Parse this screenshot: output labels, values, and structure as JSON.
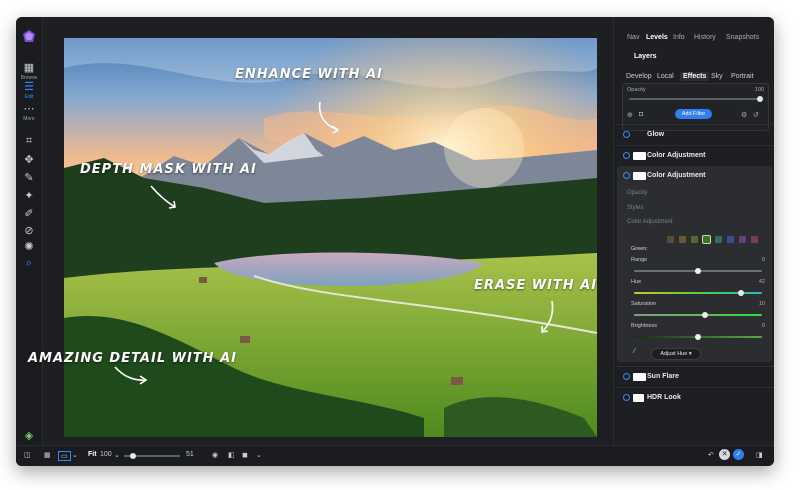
{
  "toolbar": {
    "browse_label": "Browse",
    "edit_label": "Edit",
    "more_label": "More"
  },
  "photo": {
    "callouts": [
      "ENHANCE WITH AI",
      "DEPTH MASK WITH AI",
      "ERASE WITH AI",
      "AMAZING DETAIL WITH AI"
    ]
  },
  "panel": {
    "top_tabs": [
      "Nav",
      "Levels",
      "Info",
      "History",
      "Snapshots"
    ],
    "active_top_tab": "Levels",
    "layers_title": "Layers",
    "sub_tabs": [
      "Develop",
      "Local",
      "Effects",
      "Sky",
      "Portrait"
    ],
    "active_sub_tab": "Effects",
    "opacity_label": "Opacity",
    "opacity_value": "100",
    "add_filter_label": "Add Filter",
    "filters": {
      "glow": "Glow",
      "color_adjustment_1": "Color Adjustment",
      "color_adjustment_2": "Color Adjustment",
      "sun_flare": "Sun Flare",
      "hdr_look": "HDR Look"
    },
    "expanded": {
      "sections": [
        "Opacity",
        "Styles",
        "Color Adjustment"
      ],
      "group_label": "Green:",
      "swatches": [
        "#5b4a3a",
        "#6b5a2c",
        "#5f6328",
        "#3f6e2e",
        "#2f6e64",
        "#3b4f8a",
        "#6a3c7e",
        "#7a3b60"
      ],
      "rows": [
        {
          "label": "Range",
          "value": "0"
        },
        {
          "label": "Hue",
          "value": "42"
        },
        {
          "label": "Saturation",
          "value": "10"
        },
        {
          "label": "Brightness",
          "value": "0"
        }
      ],
      "adjust_button": "Adjust Hue"
    }
  },
  "bottom": {
    "fit_label": "Fit",
    "zoom_value": "100",
    "slider_value": "51"
  },
  "colors": {
    "accent": "#2f8cff",
    "panel_bg": "#1e1f22"
  }
}
